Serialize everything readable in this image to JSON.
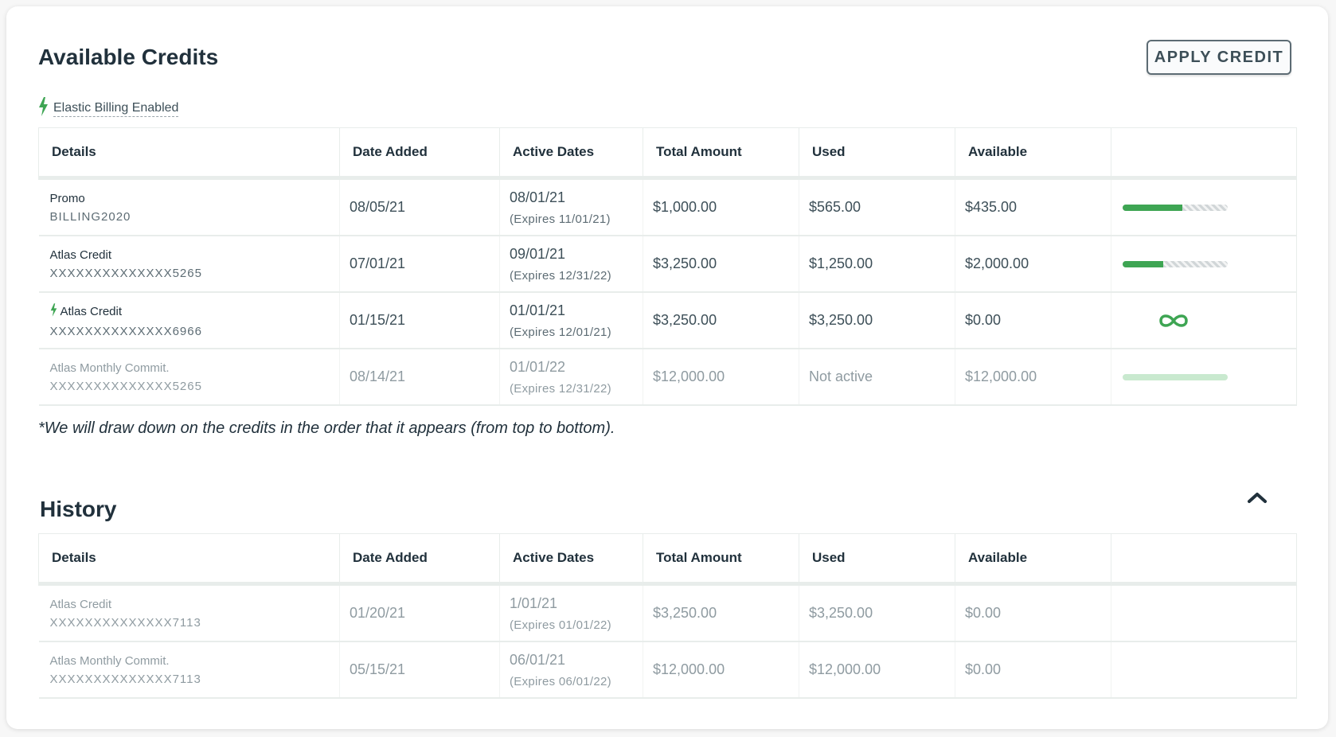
{
  "credits": {
    "title": "Available Credits",
    "apply_button": "APPLY CREDIT",
    "elastic_label": "Elastic Billing Enabled",
    "columns": [
      "Details",
      "Date Added",
      "Active Dates",
      "Total Amount",
      "Used",
      "Available"
    ],
    "rows": [
      {
        "name": "Promo",
        "code": "BILLING2020",
        "added": "08/05/21",
        "active": "08/01/21",
        "expires": "(Expires 11/01/21)",
        "total": "$1,000.00",
        "used": "$565.00",
        "available": "$435.00",
        "used_fraction": 0.565,
        "elastic": false,
        "muted": false
      },
      {
        "name": "Atlas Credit",
        "code": "XXXXXXXXXXXXXX5265",
        "added": "07/01/21",
        "active": "09/01/21",
        "expires": "(Expires 12/31/22)",
        "total": "$3,250.00",
        "used": "$1,250.00",
        "available": "$2,000.00",
        "used_fraction": 0.385,
        "elastic": false,
        "muted": false
      },
      {
        "name": "Atlas Credit",
        "code": "XXXXXXXXXXXXXX6966",
        "added": "01/15/21",
        "active": "01/01/21",
        "expires": "(Expires 12/01/21)",
        "total": "$3,250.00",
        "used": "$3,250.00",
        "available": "$0.00",
        "indicator": "infinity-icon",
        "elastic": true,
        "muted": false
      },
      {
        "name": "Atlas Monthly Commit.",
        "code": "XXXXXXXXXXXXXX5265",
        "added": "08/14/21",
        "active": "01/01/22",
        "expires": "(Expires 12/31/22)",
        "total": "$12,000.00",
        "used": "Not active",
        "available": "$12,000.00",
        "used_fraction": 0,
        "elastic": false,
        "muted": true
      }
    ],
    "footnote": "*We will draw down on the credits in the order that it appears (from top to bottom)."
  },
  "history": {
    "title": "History",
    "columns": [
      "Details",
      "Date Added",
      "Active Dates",
      "Total Amount",
      "Used",
      "Available"
    ],
    "rows": [
      {
        "name": "Atlas Credit",
        "code": "XXXXXXXXXXXXXX7113",
        "added": "01/20/21",
        "active": "1/01/21",
        "expires": "(Expires 01/01/22)",
        "total": "$3,250.00",
        "used": "$3,250.00",
        "available": "$0.00"
      },
      {
        "name": "Atlas Monthly Commit.",
        "code": "XXXXXXXXXXXXXX7113",
        "added": "05/15/21",
        "active": "06/01/21",
        "expires": "(Expires 06/01/22)",
        "total": "$12,000.00",
        "used": "$12,000.00",
        "available": "$0.00"
      }
    ]
  },
  "colors": {
    "accent_green": "#3ea553",
    "text_dark": "#21313c",
    "muted_text": "#8f9ba1"
  }
}
